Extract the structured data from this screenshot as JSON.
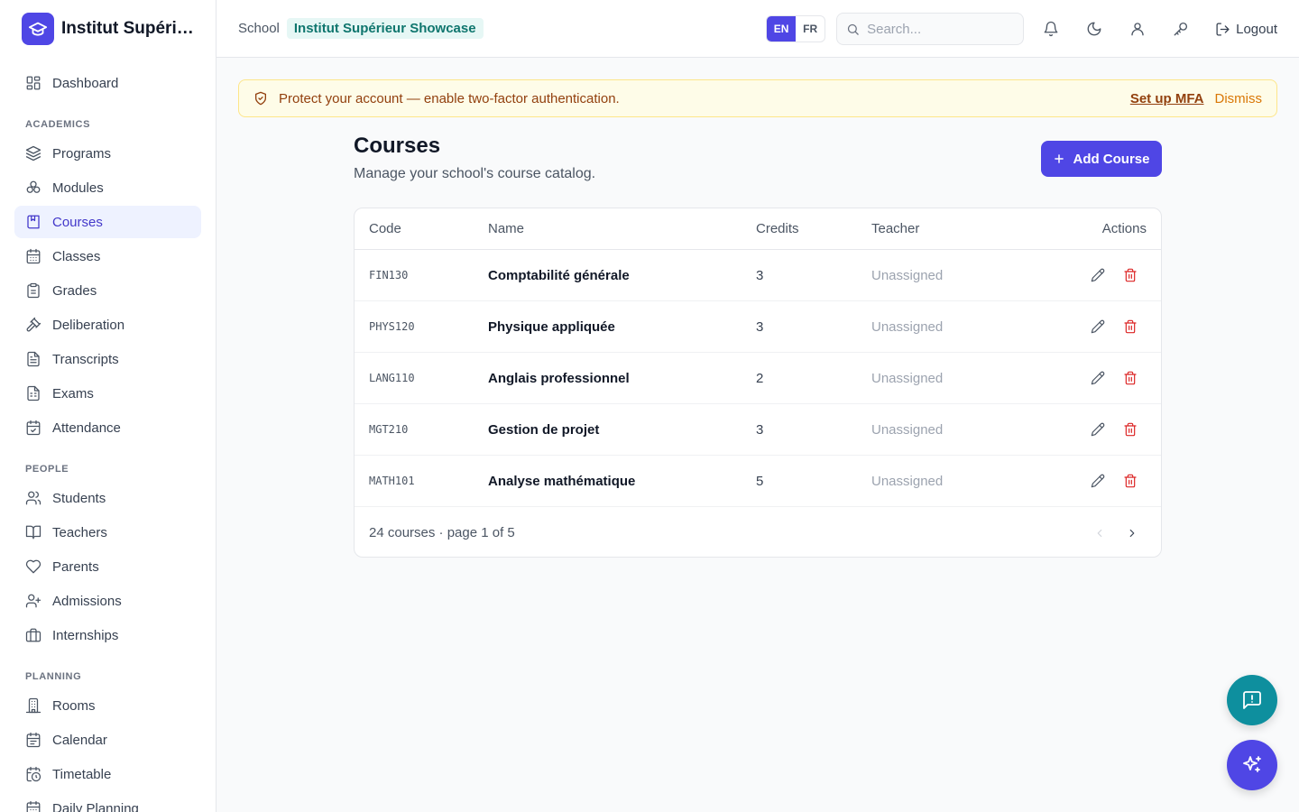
{
  "brand": {
    "name": "Institut Supérieur Showcase"
  },
  "sidebar": {
    "top": [
      {
        "label": "Dashboard",
        "icon": "dashboard-icon"
      }
    ],
    "sections": [
      {
        "title": "ACADEMICS",
        "items": [
          {
            "label": "Programs",
            "icon": "layers-icon"
          },
          {
            "label": "Modules",
            "icon": "modules-icon"
          },
          {
            "label": "Courses",
            "icon": "book-icon",
            "active": true
          },
          {
            "label": "Classes",
            "icon": "calendar-icon"
          },
          {
            "label": "Grades",
            "icon": "clipboard-icon"
          },
          {
            "label": "Deliberation",
            "icon": "gavel-icon"
          },
          {
            "label": "Transcripts",
            "icon": "file-text-icon"
          },
          {
            "label": "Exams",
            "icon": "file-sheet-icon"
          },
          {
            "label": "Attendance",
            "icon": "calendar-check-icon"
          }
        ]
      },
      {
        "title": "PEOPLE",
        "items": [
          {
            "label": "Students",
            "icon": "users-icon"
          },
          {
            "label": "Teachers",
            "icon": "book-open-icon"
          },
          {
            "label": "Parents",
            "icon": "heart-icon"
          },
          {
            "label": "Admissions",
            "icon": "user-plus-icon"
          },
          {
            "label": "Internships",
            "icon": "briefcase-icon"
          }
        ]
      },
      {
        "title": "PLANNING",
        "items": [
          {
            "label": "Rooms",
            "icon": "building-icon"
          },
          {
            "label": "Calendar",
            "icon": "calendar-days-icon"
          },
          {
            "label": "Timetable",
            "icon": "calendar-clock-icon"
          },
          {
            "label": "Daily Planning",
            "icon": "calendar-icon"
          }
        ]
      }
    ]
  },
  "header": {
    "crumb_school": "School",
    "crumb_tenant": "Institut Supérieur Showcase",
    "lang_en": "EN",
    "lang_fr": "FR",
    "search_placeholder": "Search...",
    "logout_label": "Logout"
  },
  "banner": {
    "text": "Protect your account — enable two-factor authentication.",
    "setup_label": "Set up MFA",
    "dismiss_label": "Dismiss"
  },
  "page": {
    "title": "Courses",
    "subtitle": "Manage your school's course catalog.",
    "add_label": "Add Course"
  },
  "table": {
    "headers": {
      "code": "Code",
      "name": "Name",
      "credits": "Credits",
      "teacher": "Teacher",
      "actions": "Actions"
    },
    "rows": [
      {
        "code": "FIN130",
        "name": "Comptabilité générale",
        "credits": "3",
        "teacher": "Unassigned"
      },
      {
        "code": "PHYS120",
        "name": "Physique appliquée",
        "credits": "3",
        "teacher": "Unassigned"
      },
      {
        "code": "LANG110",
        "name": "Anglais professionnel",
        "credits": "2",
        "teacher": "Unassigned"
      },
      {
        "code": "MGT210",
        "name": "Gestion de projet",
        "credits": "3",
        "teacher": "Unassigned"
      },
      {
        "code": "MATH101",
        "name": "Analyse mathématique",
        "credits": "5",
        "teacher": "Unassigned"
      }
    ],
    "footer": "24 courses · page 1 of 5"
  },
  "colors": {
    "accent": "#4f46e5",
    "teal": "#0e8f9e",
    "danger": "#dc2626",
    "warning_bg": "#fefce8"
  }
}
